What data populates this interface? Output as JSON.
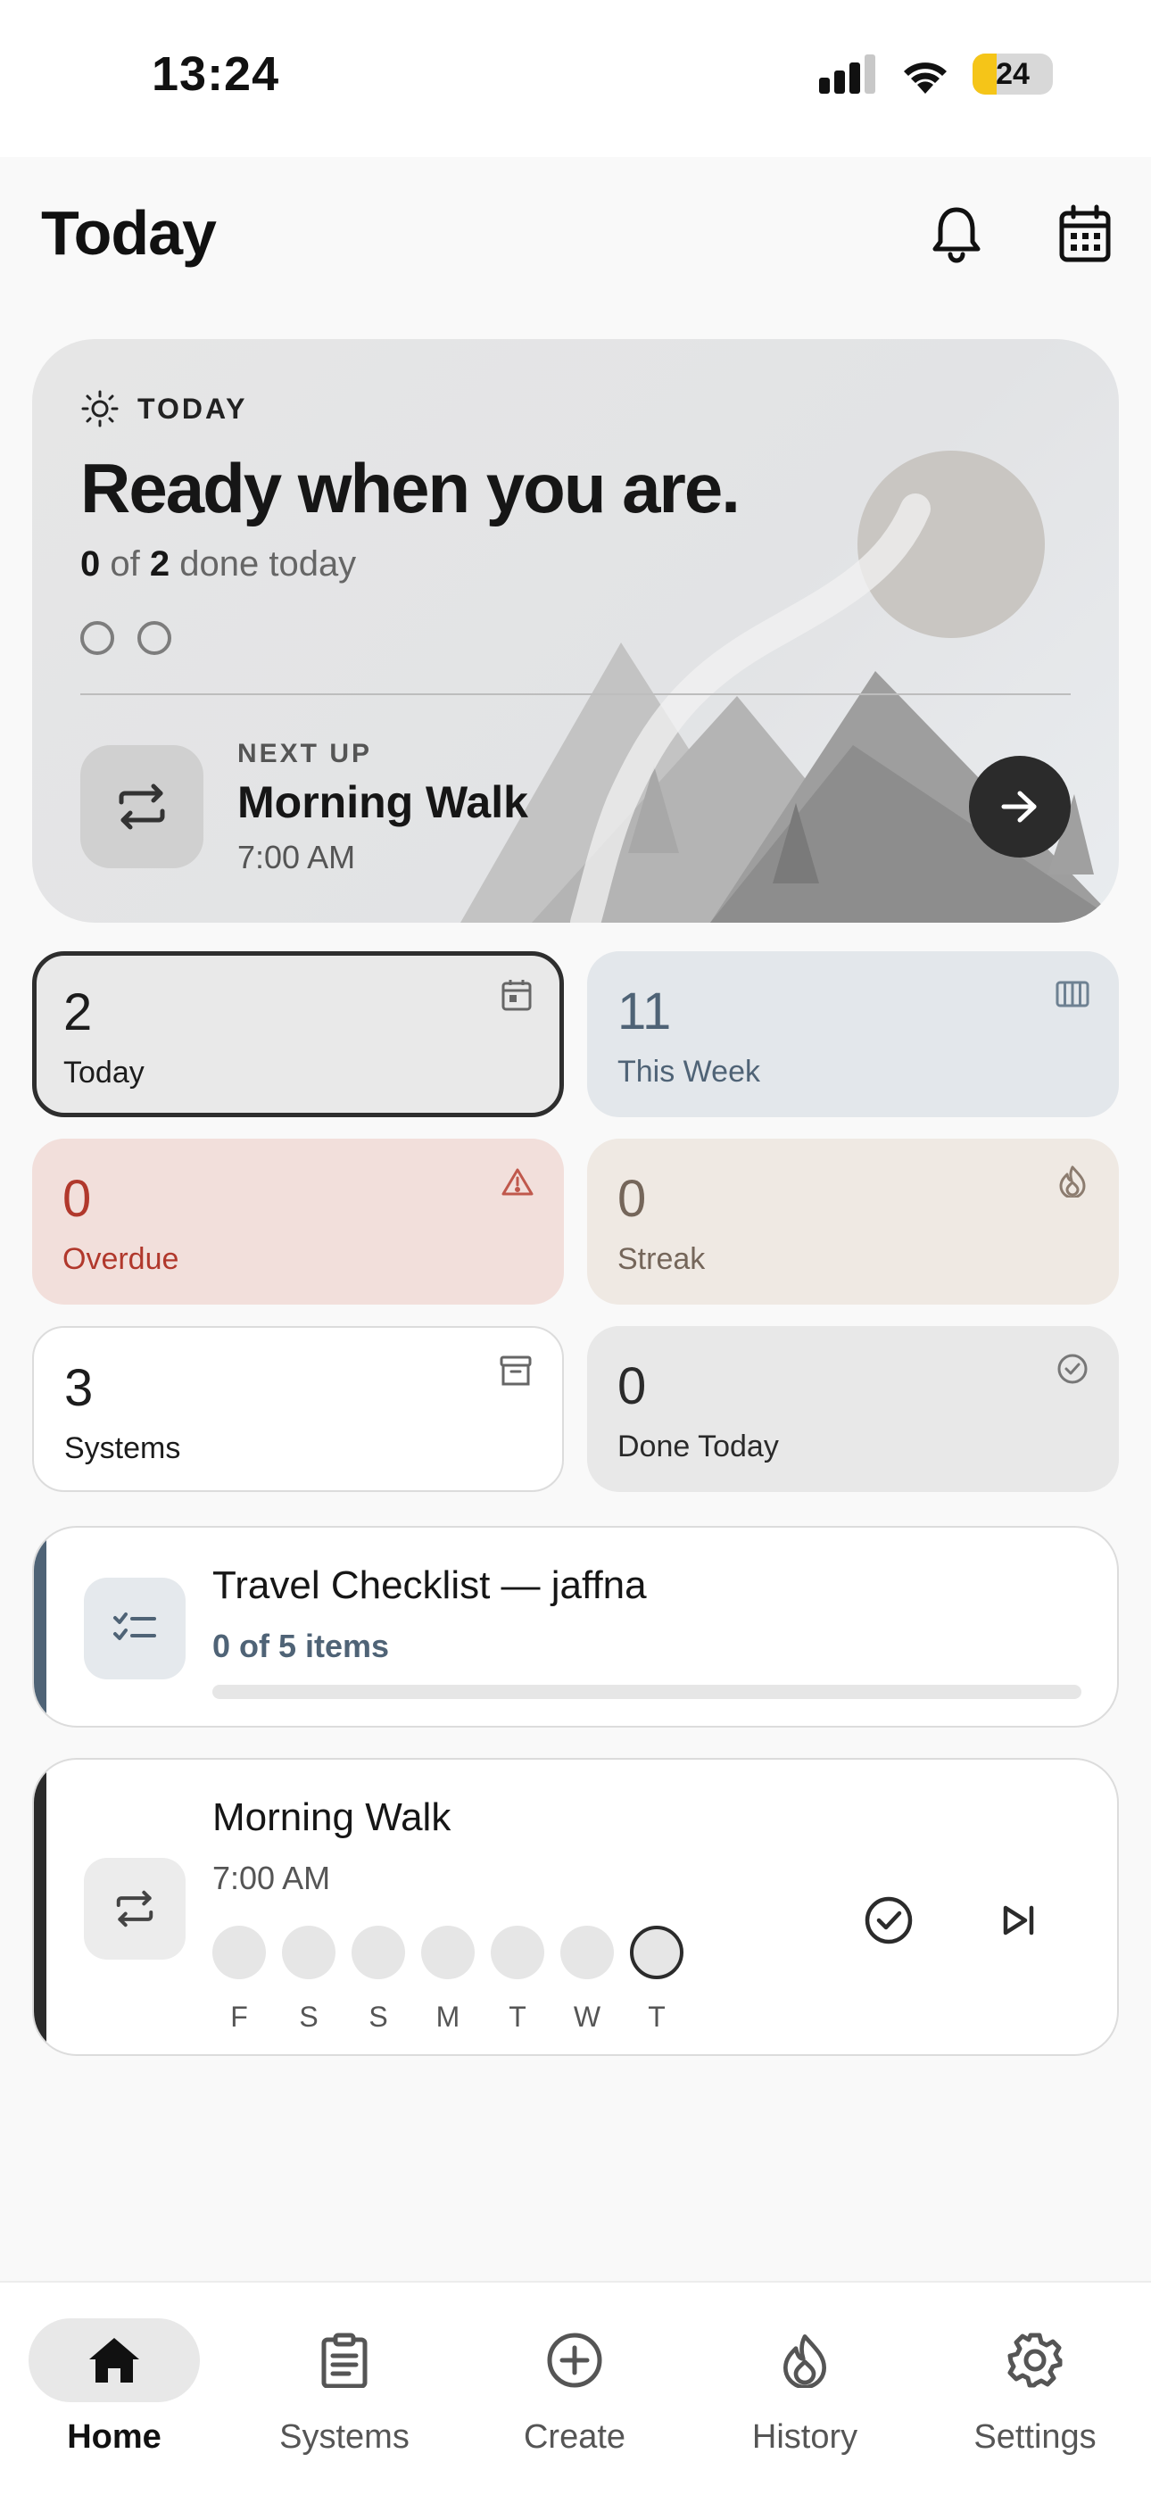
{
  "status_bar": {
    "time": "13:24",
    "battery": "24"
  },
  "header": {
    "title": "Today",
    "icons": [
      "bell-icon",
      "calendar-icon"
    ]
  },
  "hero": {
    "eyebrow": "TODAY",
    "title": "Ready when you are.",
    "done_count": "0",
    "of_text": "of",
    "total_count": "2",
    "done_text": "done today",
    "next_up_label": "NEXT UP",
    "next_title": "Morning Walk",
    "next_time": "7:00 AM"
  },
  "stats": [
    {
      "value": "2",
      "label": "Today",
      "icon": "calendar-icon"
    },
    {
      "value": "11",
      "label": "This Week",
      "icon": "week-columns-icon"
    },
    {
      "value": "0",
      "label": "Overdue",
      "icon": "warning-icon"
    },
    {
      "value": "0",
      "label": "Streak",
      "icon": "flame-icon"
    },
    {
      "value": "3",
      "label": "Systems",
      "icon": "archive-icon"
    },
    {
      "value": "0",
      "label": "Done Today",
      "icon": "check-circle-icon"
    }
  ],
  "checklist": {
    "title": "Travel Checklist — jaffna",
    "subtitle": "0 of 5 items",
    "progress": 0
  },
  "routine": {
    "title": "Morning Walk",
    "time": "7:00 AM",
    "days": [
      "F",
      "S",
      "S",
      "M",
      "T",
      "W",
      "T"
    ]
  },
  "tabs": [
    {
      "label": "Home",
      "icon": "home-icon",
      "active": true
    },
    {
      "label": "Systems",
      "icon": "clipboard-icon"
    },
    {
      "label": "Create",
      "icon": "plus-circle-icon"
    },
    {
      "label": "History",
      "icon": "flame-icon"
    },
    {
      "label": "Settings",
      "icon": "gear-icon"
    }
  ]
}
